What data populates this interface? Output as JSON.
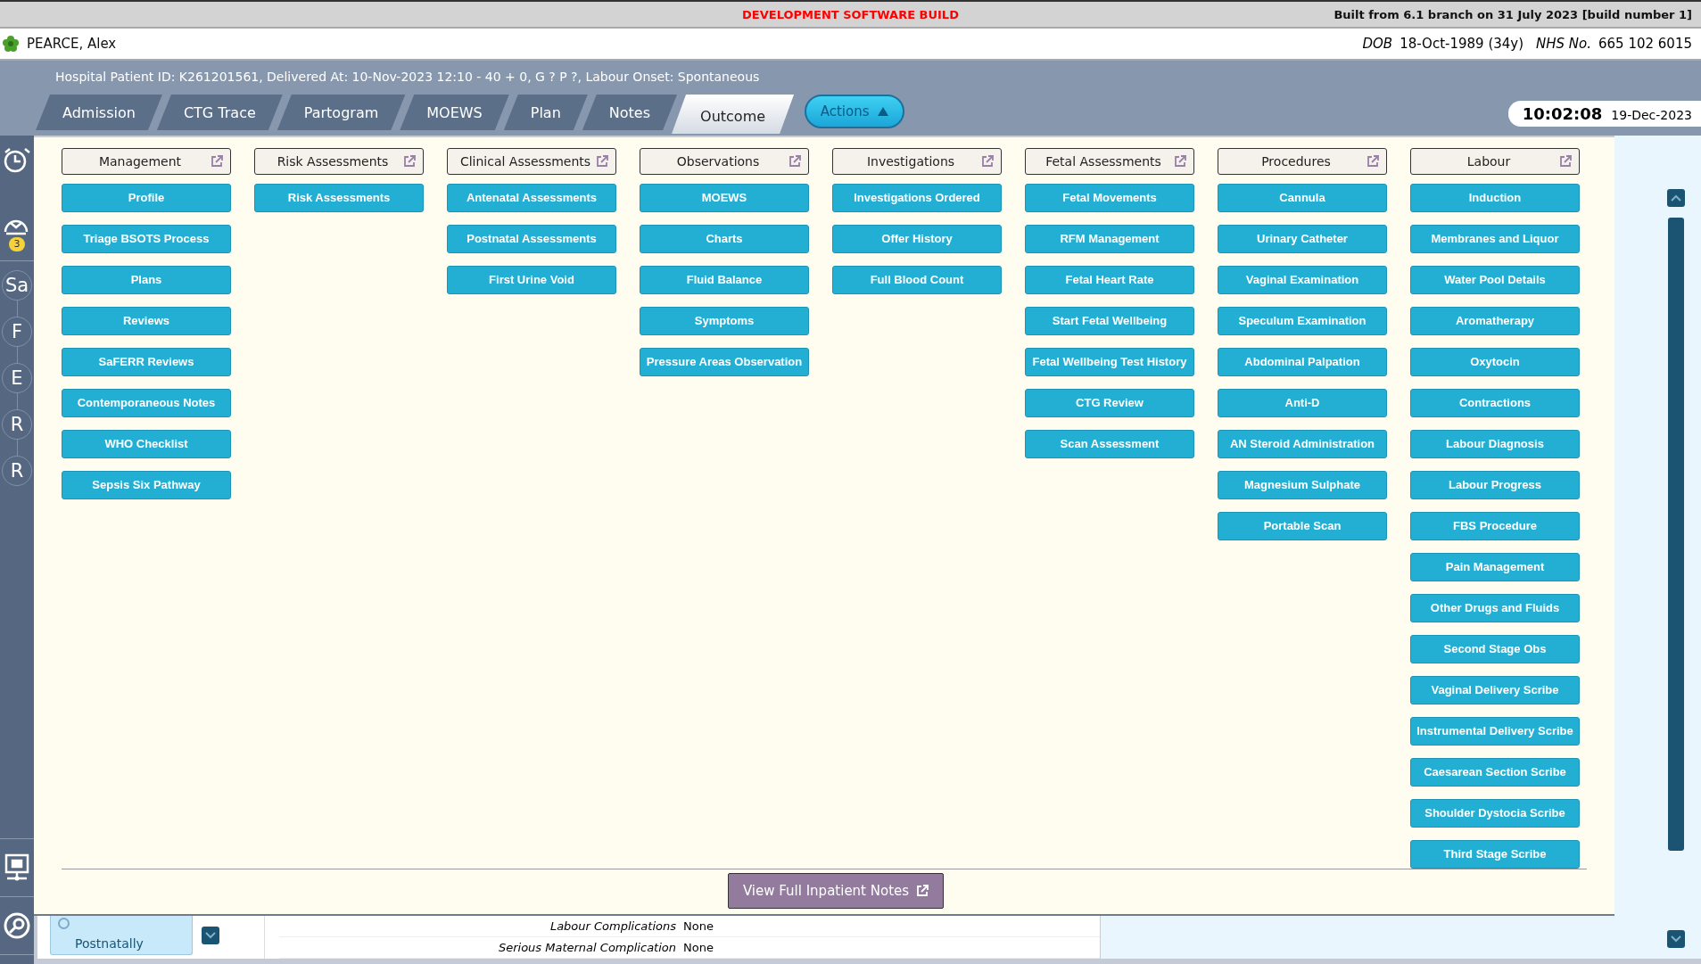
{
  "banner": {
    "notice": "DEVELOPMENT SOFTWARE BUILD",
    "build": "Built from 6.1 branch on 31 July 2023 [build number 1]"
  },
  "patient": {
    "name": "PEARCE, Alex",
    "dob_label": "DOB",
    "dob": "18-Oct-1989 (34y)",
    "nhs_label": "NHS No.",
    "nhs": "665 102 6015"
  },
  "summary": "Hospital Patient ID: K261201561, Delivered At: 10-Nov-2023 12:10 - 40 + 0, G ? P ?,   Labour Onset: Spontaneous",
  "tabs": [
    {
      "label": "Admission",
      "selected": false
    },
    {
      "label": "CTG Trace",
      "selected": false
    },
    {
      "label": "Partogram",
      "selected": false
    },
    {
      "label": "MOEWS",
      "selected": false
    },
    {
      "label": "Plan",
      "selected": false
    },
    {
      "label": "Notes",
      "selected": false
    },
    {
      "label": "Outcome",
      "selected": true
    }
  ],
  "actions_button": {
    "label": "Actions"
  },
  "clock": {
    "time": "10:02:08",
    "date": "19-Dec-2023"
  },
  "sidebar": {
    "alerts_badge": "3",
    "letters": [
      "Sa",
      "F",
      "E",
      "R",
      "R"
    ]
  },
  "sections": [
    {
      "title": "Management",
      "items": [
        "Profile",
        "Triage BSOTS Process",
        "Plans",
        "Reviews",
        "SaFERR Reviews",
        "Contemporaneous Notes",
        "WHO Checklist",
        "Sepsis Six Pathway"
      ]
    },
    {
      "title": "Risk Assessments",
      "items": [
        "Risk Assessments"
      ]
    },
    {
      "title": "Clinical Assessments",
      "items": [
        "Antenatal Assessments",
        "Postnatal Assessments",
        "First Urine Void"
      ]
    },
    {
      "title": "Observations",
      "items": [
        "MOEWS",
        "Charts",
        "Fluid Balance",
        "Symptoms",
        "Pressure Areas Observation"
      ]
    },
    {
      "title": "Investigations",
      "items": [
        "Investigations Ordered",
        "Offer History",
        "Full Blood Count"
      ]
    },
    {
      "title": "Fetal Assessments",
      "items": [
        "Fetal Movements",
        "RFM Management",
        "Fetal Heart Rate",
        "Start Fetal Wellbeing",
        "Fetal Wellbeing Test History",
        "CTG Review",
        "Scan Assessment"
      ]
    },
    {
      "title": "Procedures",
      "items": [
        "Cannula",
        "Urinary Catheter",
        "Vaginal Examination",
        "Speculum Examination",
        "Abdominal Palpation",
        "Anti-D",
        "AN Steroid Administration",
        "Magnesium Sulphate",
        "Portable Scan"
      ]
    },
    {
      "title": "Labour",
      "items": [
        "Induction",
        "Membranes and Liquor",
        "Water Pool Details",
        "Aromatherapy",
        "Oxytocin",
        "Contractions",
        "Labour Diagnosis",
        "Labour Progress",
        "FBS Procedure",
        "Pain Management",
        "Other Drugs and Fluids",
        "Second Stage Obs",
        "Vaginal Delivery Scribe",
        "Instrumental Delivery Scribe",
        "Caesarean Section Scribe",
        "Shoulder Dystocia Scribe",
        "Third Stage Scribe"
      ]
    }
  ],
  "footer_button": {
    "label": "View Full Inpatient Notes"
  },
  "background_form": {
    "option": {
      "label": "Postnatally",
      "selected": false
    },
    "rows": [
      {
        "label": "Labour Complications",
        "value": "None"
      },
      {
        "label": "Serious Maternal Complication",
        "value": "None"
      }
    ]
  }
}
